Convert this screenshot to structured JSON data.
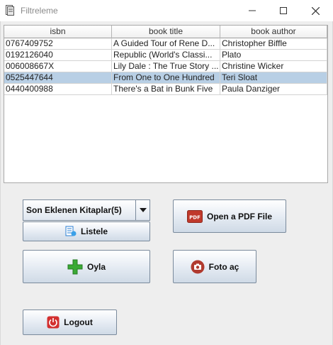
{
  "window": {
    "title": "Filtreleme"
  },
  "table": {
    "columns": [
      "isbn",
      "book title",
      "book author"
    ],
    "rows": [
      [
        "0767409752",
        "A Guided Tour of Rene D...",
        "Christopher  Biffle"
      ],
      [
        "0192126040",
        "Republic (World's Classi...",
        "Plato"
      ],
      [
        "006008667X",
        "Lily Dale : The True Story ...",
        "Christine Wicker"
      ],
      [
        "0525447644",
        "From One to One Hundred",
        "Teri Sloat"
      ],
      [
        "0440400988",
        "There's a Bat in Bunk Five",
        "Paula Danziger"
      ]
    ],
    "selected_row_index": 3
  },
  "combo": {
    "selected": "Son Eklenen Kitaplar(5)"
  },
  "buttons": {
    "listele": "Listele",
    "open_pdf": "Open a PDF File",
    "oyla": "Oyla",
    "foto": "Foto aç",
    "logout": "Logout"
  },
  "icons": {
    "app": "document-icon",
    "list": "list-icon",
    "pdf": "pdf-icon",
    "plus": "plus-icon",
    "camera": "camera-icon",
    "power": "power-icon"
  },
  "colors": {
    "selection": "#b8cfe5",
    "pdf_red": "#c0392b",
    "plus_green": "#3aaa35",
    "power_red": "#d32f2f"
  },
  "pdf_icon_text": "PDF"
}
